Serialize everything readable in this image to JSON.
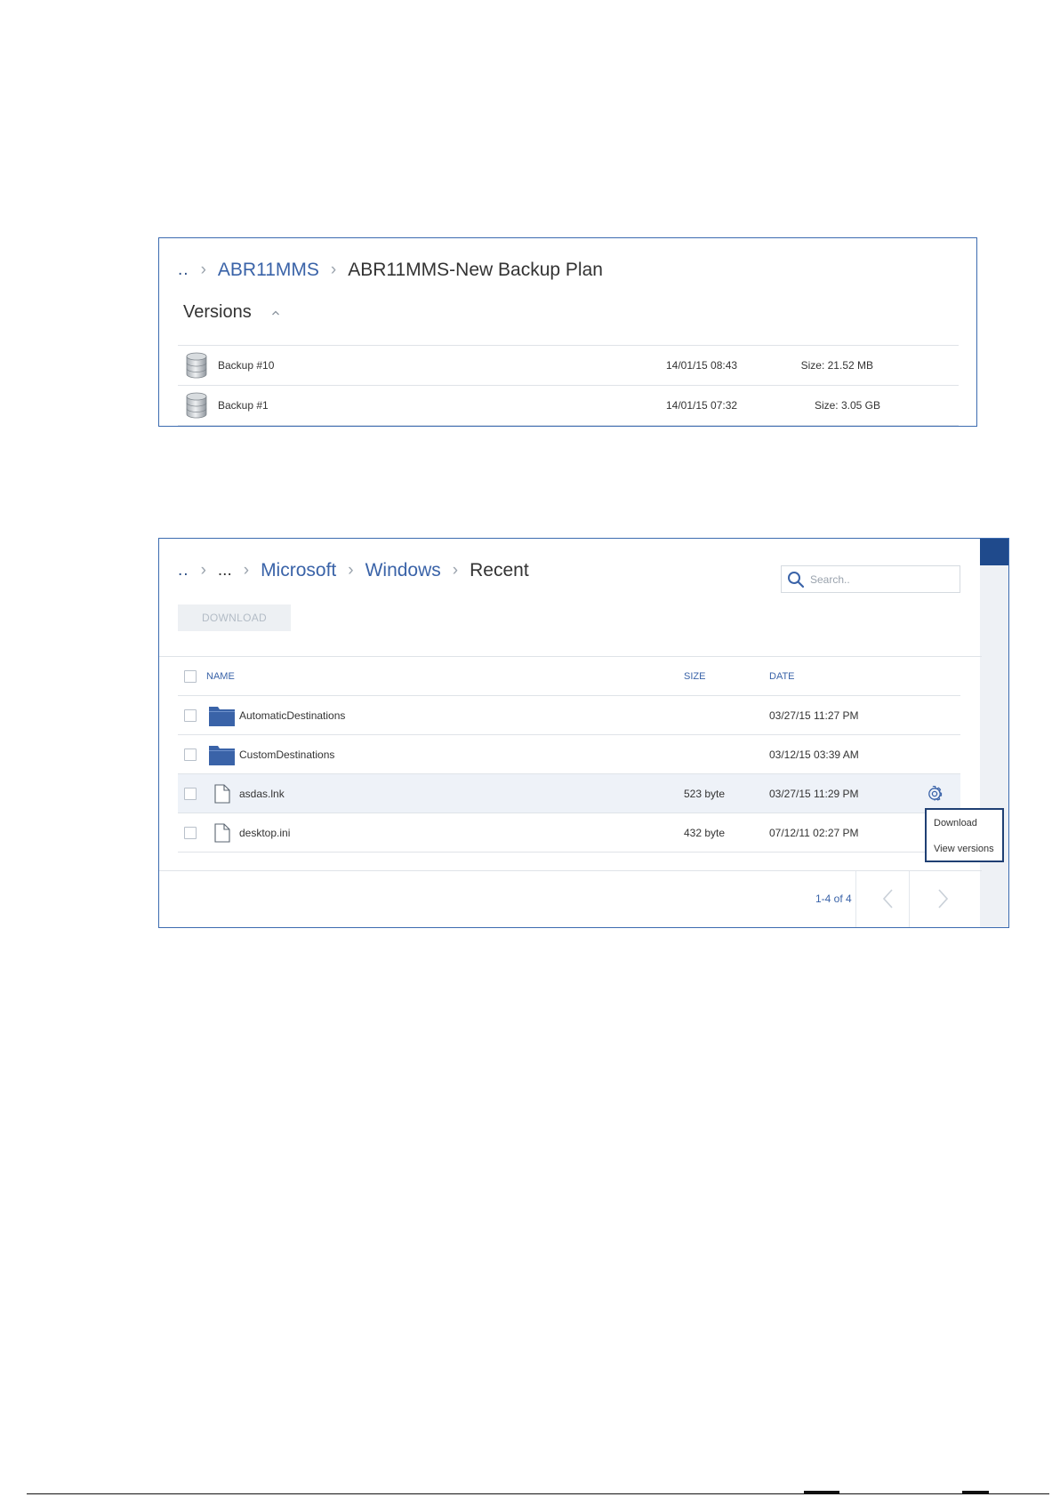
{
  "versions_panel": {
    "breadcrumb": {
      "root": "..",
      "link": "ABR11MMS",
      "current": "ABR11MMS-New Backup Plan"
    },
    "section_title": "Versions",
    "rows": [
      {
        "name": "Backup #10",
        "date": "14/01/15 08:43",
        "size": "Size: 21.52 MB"
      },
      {
        "name": "Backup #1",
        "date": "14/01/15 07:32",
        "size": "Size: 3.05 GB"
      }
    ]
  },
  "files_panel": {
    "breadcrumb": {
      "root": "..",
      "ellipsis": "...",
      "links": [
        "Microsoft",
        "Windows"
      ],
      "current": "Recent"
    },
    "search": {
      "placeholder": "Search..",
      "value": ""
    },
    "download_button": "DOWNLOAD",
    "columns": {
      "name": "NAME",
      "size": "SIZE",
      "date": "DATE"
    },
    "rows": [
      {
        "type": "folder",
        "name": "AutomaticDestinations",
        "size": "",
        "date": "03/27/15 11:27 PM"
      },
      {
        "type": "folder",
        "name": "CustomDestinations",
        "size": "",
        "date": "03/12/15 03:39 AM"
      },
      {
        "type": "file",
        "name": "asdas.lnk",
        "size": "523 byte",
        "date": "03/27/15 11:29 PM"
      },
      {
        "type": "file",
        "name": "desktop.ini",
        "size": "432 byte",
        "date": "07/12/11 02:27 PM"
      }
    ],
    "context_menu": [
      "Download",
      "View versions"
    ],
    "pager": "1-4 of 4"
  },
  "colors": {
    "accent": "#3a63a8",
    "panel_border": "#3c6bb0",
    "folder": "#3a63a8",
    "scroll_thumb": "#1f4a8c",
    "hover_row": "#eef2f8"
  },
  "icons": [
    "chevron-right-icon",
    "chevron-up-icon",
    "database-icon",
    "search-icon",
    "folder-icon",
    "file-icon",
    "gear-icon",
    "chevron-left-icon"
  ]
}
